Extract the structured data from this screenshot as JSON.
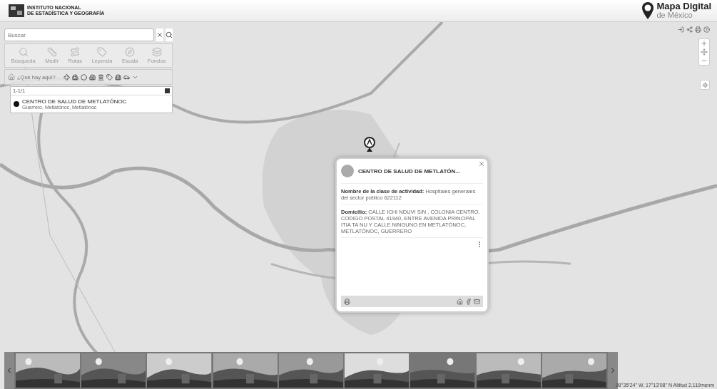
{
  "header": {
    "logo_line1": "INSTITUTO NACIONAL",
    "logo_line2": "DE ESTADÍSTICA Y GEOGRAFÍA",
    "app_title": "Mapa Digital",
    "app_subtitle": "de México"
  },
  "search": {
    "placeholder": "Buscar"
  },
  "tools": [
    {
      "label": "Búsqueda"
    },
    {
      "label": "Medir"
    },
    {
      "label": "Rutas"
    },
    {
      "label": "Leyenda"
    },
    {
      "label": "Escala"
    },
    {
      "label": "Fondos"
    }
  ],
  "where": {
    "placeholder": "¿Qué hay aquí?"
  },
  "results": {
    "count": "1-1/1",
    "items": [
      {
        "title": "CENTRO DE SALUD DE METLATÓNOC",
        "subtitle": "Guerrero, Metlatónoc, Metlatónoc"
      }
    ]
  },
  "popup": {
    "title": "CENTRO DE SALUD DE METLATÓN...",
    "fields": [
      "**Nombre de la clase de actividad:** Hospitales generales del sector público 622112",
      "**Domicilio:** CALLE ICHI NDUVI S/N , COLONIA CENTRO, CODIGO POSTAL 41940, ENTRE AVENIDA PRINCIPAL ITIA TA NU Y CALLE NINGUNO EN METLATÓNOC, METLATÓNOC, GUERRERO"
    ]
  },
  "status": "98°35'24\" W, 17°13'08\" N  Altitud 2,119msnm"
}
